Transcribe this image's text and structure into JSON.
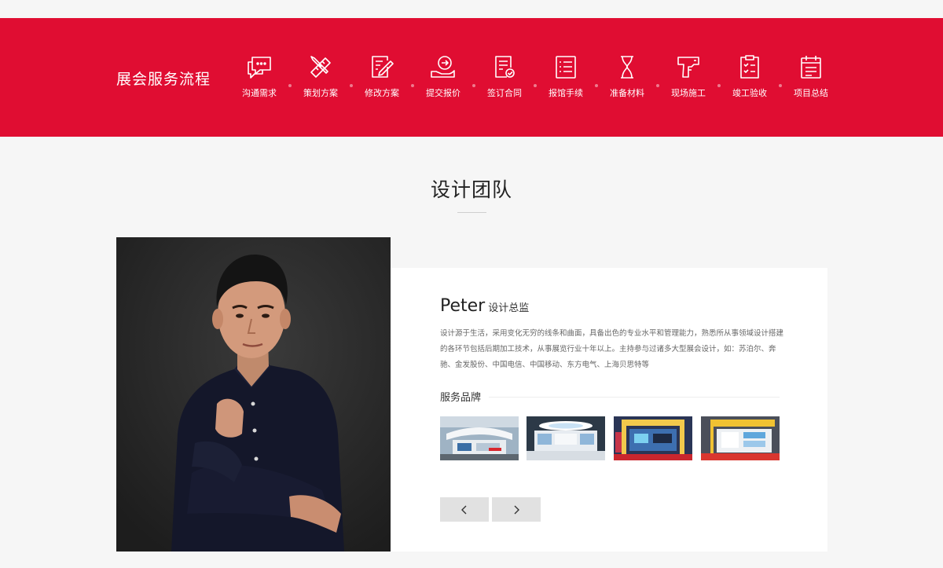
{
  "process": {
    "title": "展会服务流程",
    "steps": [
      {
        "label": "沟通需求",
        "icon": "chat-bubble-icon"
      },
      {
        "label": "策划方案",
        "icon": "ruler-pencil-icon"
      },
      {
        "label": "修改方案",
        "icon": "edit-document-icon"
      },
      {
        "label": "提交报价",
        "icon": "hand-offer-icon"
      },
      {
        "label": "签订合同",
        "icon": "contract-check-icon"
      },
      {
        "label": "报馆手续",
        "icon": "checklist-icon"
      },
      {
        "label": "准备材料",
        "icon": "hourglass-icon"
      },
      {
        "label": "现场施工",
        "icon": "drill-icon"
      },
      {
        "label": "竣工验收",
        "icon": "clipboard-check-icon"
      },
      {
        "label": "项目总结",
        "icon": "calendar-list-icon"
      }
    ]
  },
  "team": {
    "section_title": "设计团队",
    "member": {
      "name": "Peter",
      "role": "设计总监",
      "bio": "设计源于生活，采用变化无穷的线条和曲面，具备出色的专业水平和管理能力，熟悉所从事领域设计搭建的各环节包括后期加工技术，从事展览行业十年以上。主持参与过诸多大型展会设计，如：苏泊尔、奔驰、金发股份、中国电信、中国移动、东方电气、上海贝思特等"
    },
    "brands_title": "服务品牌",
    "thumbnails": [
      {
        "icon": "booth-photo-1"
      },
      {
        "icon": "booth-photo-2"
      },
      {
        "icon": "booth-photo-3"
      },
      {
        "icon": "booth-photo-4"
      }
    ],
    "nav": {
      "prev_icon": "chevron-left-icon",
      "next_icon": "chevron-right-icon"
    }
  },
  "colors": {
    "brand": "#e00d32",
    "background": "#f6f6f6",
    "card": "#ffffff",
    "button": "#e1e1e1"
  }
}
